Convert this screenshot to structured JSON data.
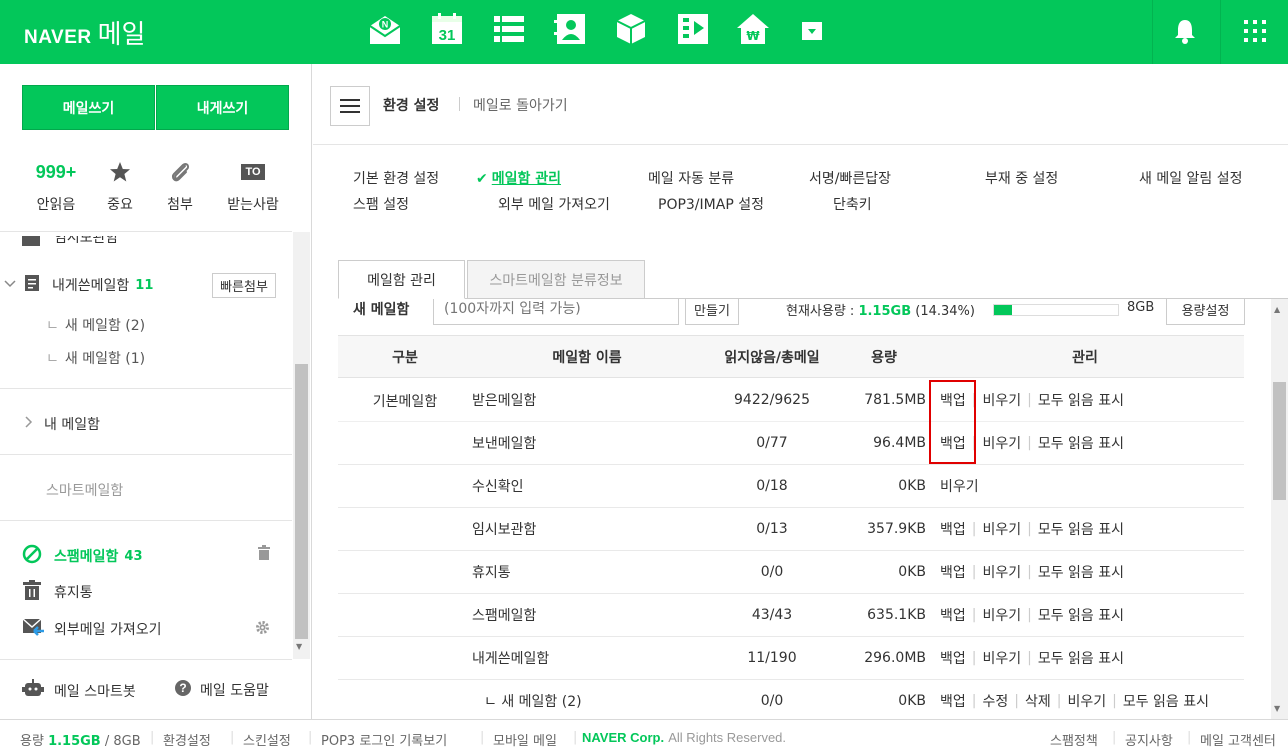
{
  "header": {
    "brand": "NAVER",
    "service": "메일",
    "apps": [
      "mail-app-icon",
      "calendar-icon",
      "list-icon",
      "contacts-icon",
      "cube-icon",
      "media-icon",
      "home-won-icon",
      "more-dropdown-icon"
    ],
    "calendar_day": "31"
  },
  "sidebar": {
    "compose_label": "메일쓰기",
    "self_compose_label": "내게쓰기",
    "quick": [
      {
        "value": "999+",
        "label": "안읽음"
      },
      {
        "label": "중요"
      },
      {
        "label": "첨부"
      },
      {
        "badge": "TO",
        "label": "받는사람"
      }
    ],
    "partial_top": "임시보관함",
    "self_mailbox": {
      "label": "내게쓴메일함",
      "count": "11",
      "action": "빠른첨부"
    },
    "sub1": "새 메일함 (2)",
    "sub2": "새 메일함 (1)",
    "my_mailbox": "내 메일함",
    "smart_mailbox": "스마트메일함",
    "spam": {
      "label": "스팸메일함",
      "count": "43"
    },
    "trash": "휴지통",
    "external": "외부메일 가져오기",
    "smartbot": "메일 스마트봇",
    "help": "메일 도움말"
  },
  "main": {
    "title": "환경 설정",
    "back": "메일로 돌아가기",
    "settings_row1": [
      "기본 환경 설정",
      "메일함 관리",
      "메일 자동 분류",
      "서명/빠른답장",
      "부재 중 설정",
      "새 메일 알림 설정"
    ],
    "settings_row2": [
      "스팸 설정",
      "외부 메일 가져오기",
      "POP3/IMAP 설정",
      "단축키"
    ],
    "tabs": [
      "메일함 관리",
      "스마트메일함 분류정보"
    ],
    "new_mailbox_label": "새 메일함",
    "new_mailbox_placeholder": "(100자까지 입력 가능)",
    "create_btn": "만들기",
    "usage_label": "현재사용량 :",
    "usage_value": "1.15GB",
    "usage_percent": "(14.34%)",
    "usage_fraction": 0.1434,
    "usage_total": "8GB",
    "usage_settings": "용량설정",
    "columns": [
      "구분",
      "메일함 이름",
      "읽지않음/총메일",
      "용량",
      "관리"
    ],
    "group": "기본메일함",
    "rows": [
      {
        "name": "받은메일함",
        "count": "9422/9625",
        "size": "781.5MB",
        "actions": [
          "백업",
          "비우기",
          "모두 읽음 표시"
        ]
      },
      {
        "name": "보낸메일함",
        "count": "0/77",
        "size": "96.4MB",
        "actions": [
          "백업",
          "비우기",
          "모두 읽음 표시"
        ]
      },
      {
        "name": "수신확인",
        "count": "0/18",
        "size": "0KB",
        "actions": [
          "비우기"
        ]
      },
      {
        "name": "임시보관함",
        "count": "0/13",
        "size": "357.9KB",
        "actions": [
          "백업",
          "비우기",
          "모두 읽음 표시"
        ]
      },
      {
        "name": "휴지통",
        "count": "0/0",
        "size": "0KB",
        "actions": [
          "백업",
          "비우기",
          "모두 읽음 표시"
        ]
      },
      {
        "name": "스팸메일함",
        "count": "43/43",
        "size": "635.1KB",
        "actions": [
          "백업",
          "비우기",
          "모두 읽음 표시"
        ]
      },
      {
        "name": "내게쓴메일함",
        "count": "11/190",
        "size": "296.0MB",
        "actions": [
          "백업",
          "비우기",
          "모두 읽음 표시"
        ]
      },
      {
        "name": "ㄴ 새 메일함 (2)",
        "count": "0/0",
        "size": "0KB",
        "actions": [
          "백업",
          "수정",
          "삭제",
          "비우기",
          "모두 읽음 표시"
        ]
      }
    ],
    "highlight_color": "#e00000"
  },
  "footer": {
    "usage_label": "용량",
    "usage_value": "1.15GB",
    "usage_total": "/ 8GB",
    "links": [
      "환경설정",
      "스킨설정",
      "POP3 로그인 기록보기",
      "모바일 메일"
    ],
    "corp": "NAVER Corp.",
    "rights": "All Rights Reserved.",
    "right_links": [
      "스팸정책",
      "공지사항",
      "메일 고객센터"
    ]
  },
  "colors": {
    "accent": "#03c75a"
  }
}
